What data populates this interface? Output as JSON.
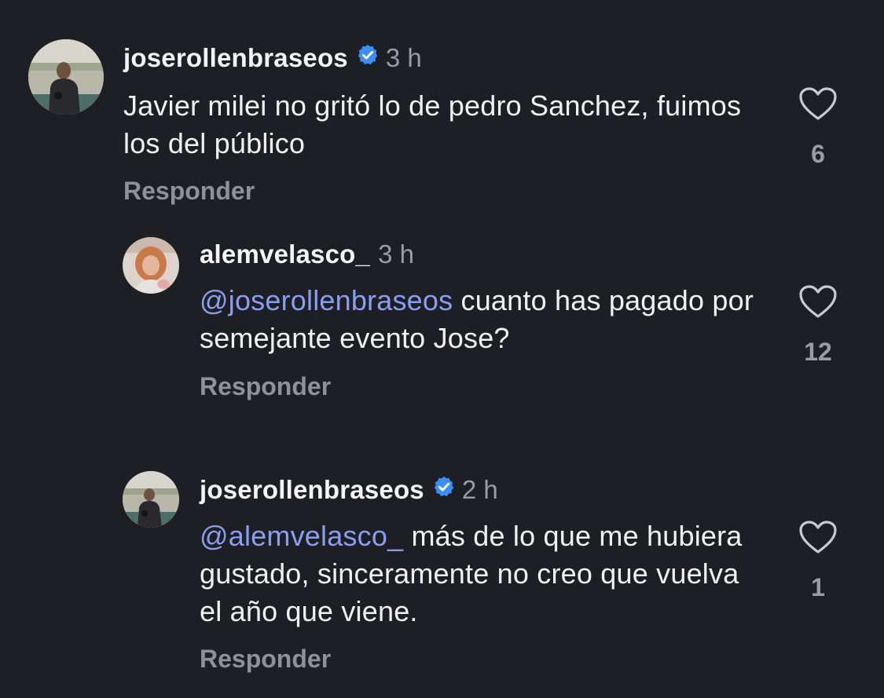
{
  "comments": [
    {
      "username": "joserollenbraseos",
      "verified": true,
      "time": "3 h",
      "mention": "",
      "text": "Javier milei no gritó lo de pedro Sanchez, fuimos los del público",
      "reply_label": "Responder",
      "likes": "6",
      "avatar": "man-photo-avatar"
    },
    {
      "username": "alemvelasco_",
      "verified": false,
      "time": "3 h",
      "mention": "@joserollenbraseos",
      "text": " cuanto has pagado por semejante evento Jose?",
      "reply_label": "Responder",
      "likes": "12",
      "avatar": "woman-photo-avatar"
    },
    {
      "username": "joserollenbraseos",
      "verified": true,
      "time": "2 h",
      "mention": "@alemvelasco_",
      "text": " más de lo que me hubiera gustado, sinceramente no creo que vuelva el año que viene.",
      "reply_label": "Responder",
      "likes": "1",
      "avatar": "man-photo-avatar"
    }
  ],
  "colors": {
    "background": "#1e1f24",
    "mention": "#8a9ef0",
    "verified": "#3b8ef7",
    "muted": "#9a9ca4"
  }
}
